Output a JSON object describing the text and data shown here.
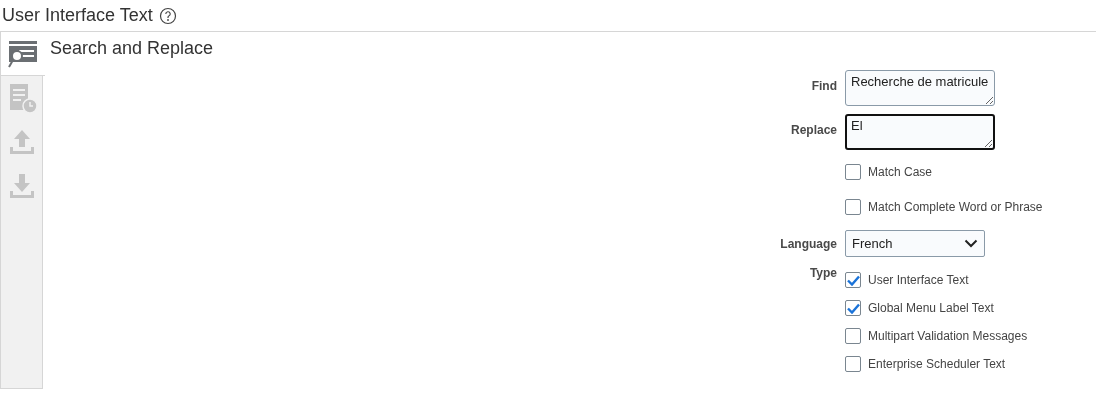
{
  "page": {
    "title": "User Interface Text"
  },
  "sidebar": {
    "tabs": [
      {
        "kind": "search",
        "selected": true
      },
      {
        "kind": "schedule",
        "selected": false
      },
      {
        "kind": "upload",
        "selected": false
      },
      {
        "kind": "download",
        "selected": false
      }
    ]
  },
  "panel": {
    "title": "Search and Replace"
  },
  "form": {
    "find": {
      "label": "Find",
      "value": "Recherche de matricule",
      "focused": false
    },
    "replace": {
      "label": "Replace",
      "value": "El",
      "focused": true
    },
    "options": [
      {
        "label": "Match Case",
        "checked": false
      },
      {
        "label": "Match Complete Word or Phrase",
        "checked": false
      }
    ],
    "language": {
      "label": "Language",
      "value": "French"
    },
    "type": {
      "label": "Type",
      "items": [
        {
          "label": "User Interface Text",
          "checked": true
        },
        {
          "label": "Global Menu Label Text",
          "checked": true
        },
        {
          "label": "Multipart Validation Messages",
          "checked": false
        },
        {
          "label": "Enterprise Scheduler Text",
          "checked": false
        }
      ]
    }
  }
}
